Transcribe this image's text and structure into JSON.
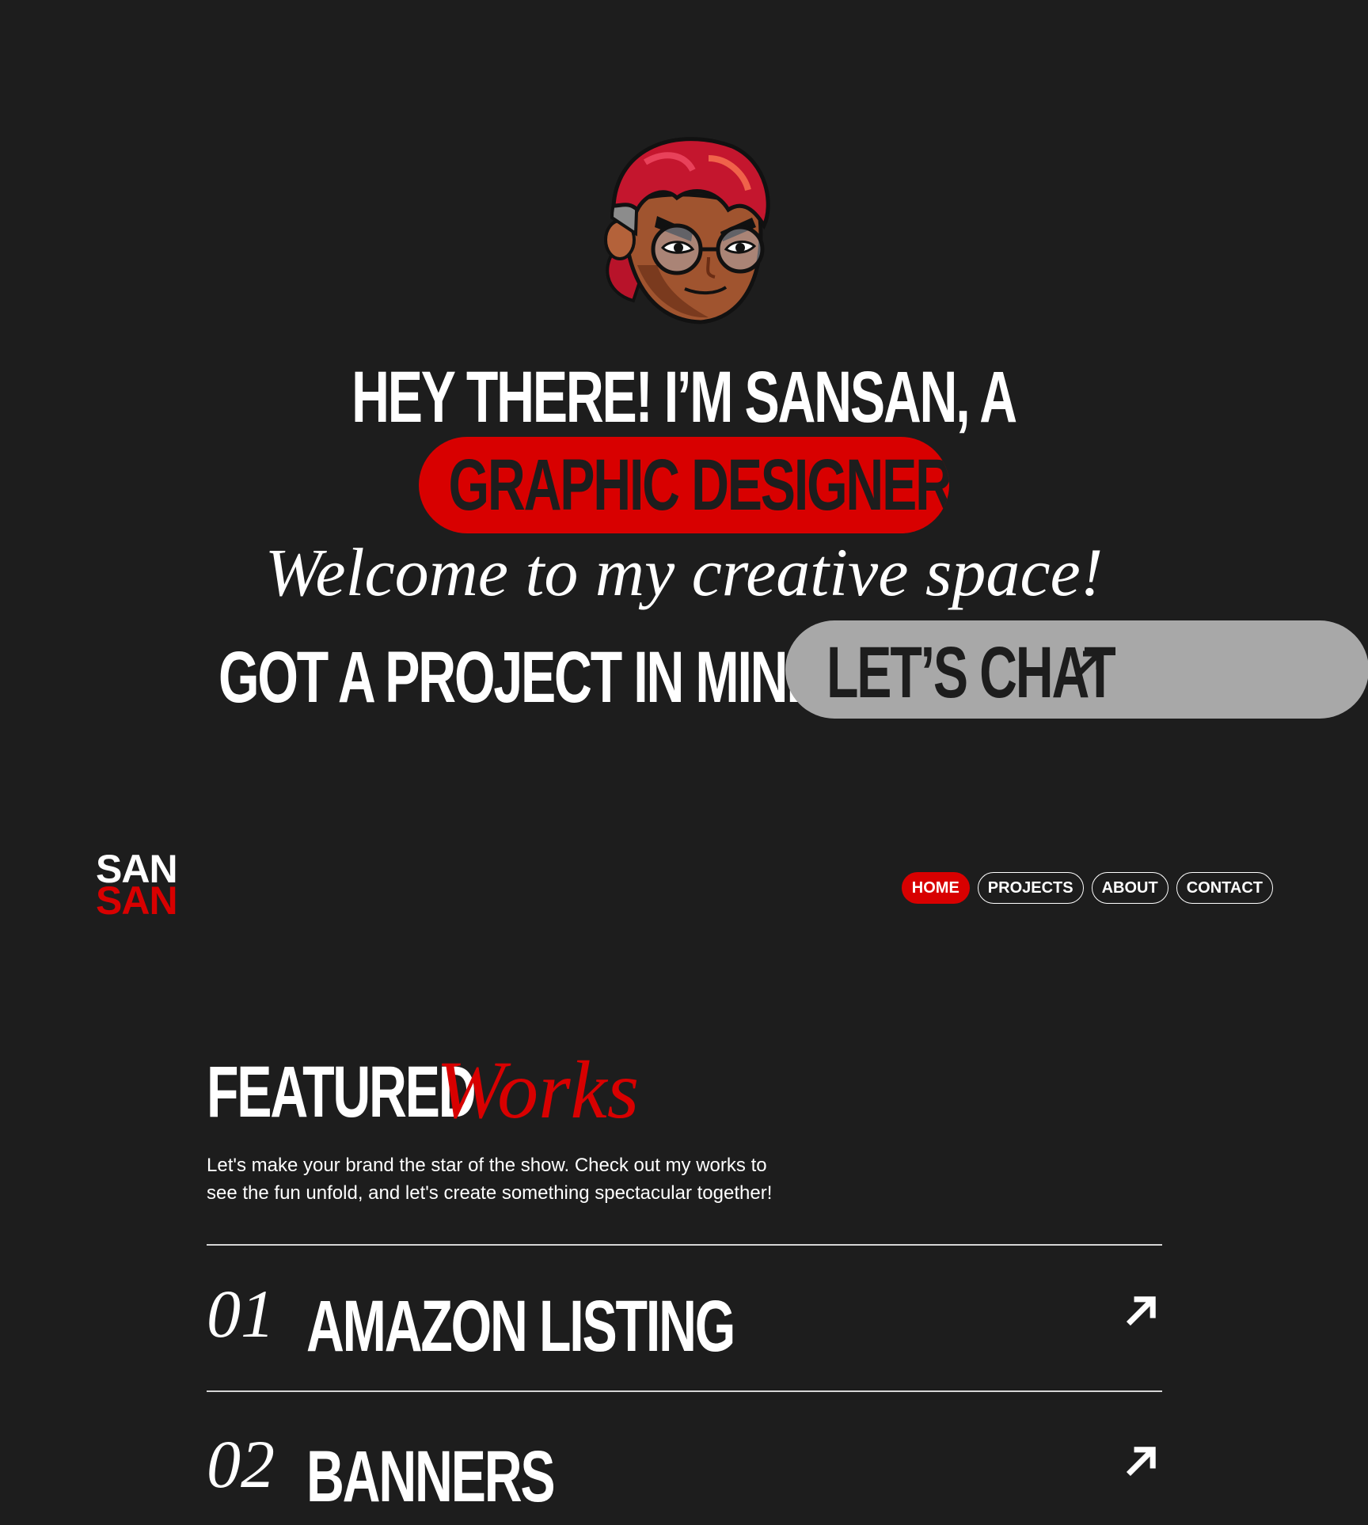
{
  "hero": {
    "greeting": "HEY THERE! I’M SANSAN, A",
    "role_pill": "GRAPHIC DESIGNER",
    "welcome": "Welcome to my creative space!",
    "project_question": "GOT A PROJECT IN MIND?",
    "chat_pill": "LET’S CHAT"
  },
  "logo": {
    "line1": "SAN",
    "line2": "SAN"
  },
  "nav": {
    "items": [
      {
        "label": "HOME",
        "active": true
      },
      {
        "label": "PROJECTS",
        "active": false
      },
      {
        "label": "ABOUT",
        "active": false
      },
      {
        "label": "CONTACT",
        "active": false
      }
    ]
  },
  "featured": {
    "title_bold": "FEATURED",
    "title_script": "Works",
    "description_line1": "Let's make your brand the star of the show. Check out my works to",
    "description_line2": "see the fun unfold, and let's create something spectacular together!",
    "works": [
      {
        "number": "01",
        "title": "AMAZON LISTING",
        "icon": "arrow-up-right-icon"
      },
      {
        "number": "02",
        "title": "BANNERS",
        "icon": "arrow-up-right-icon"
      }
    ]
  },
  "colors": {
    "background": "#1d1d1d",
    "accent_red": "#d80000",
    "pill_gray": "#a8a8a8",
    "text": "#ffffff"
  }
}
